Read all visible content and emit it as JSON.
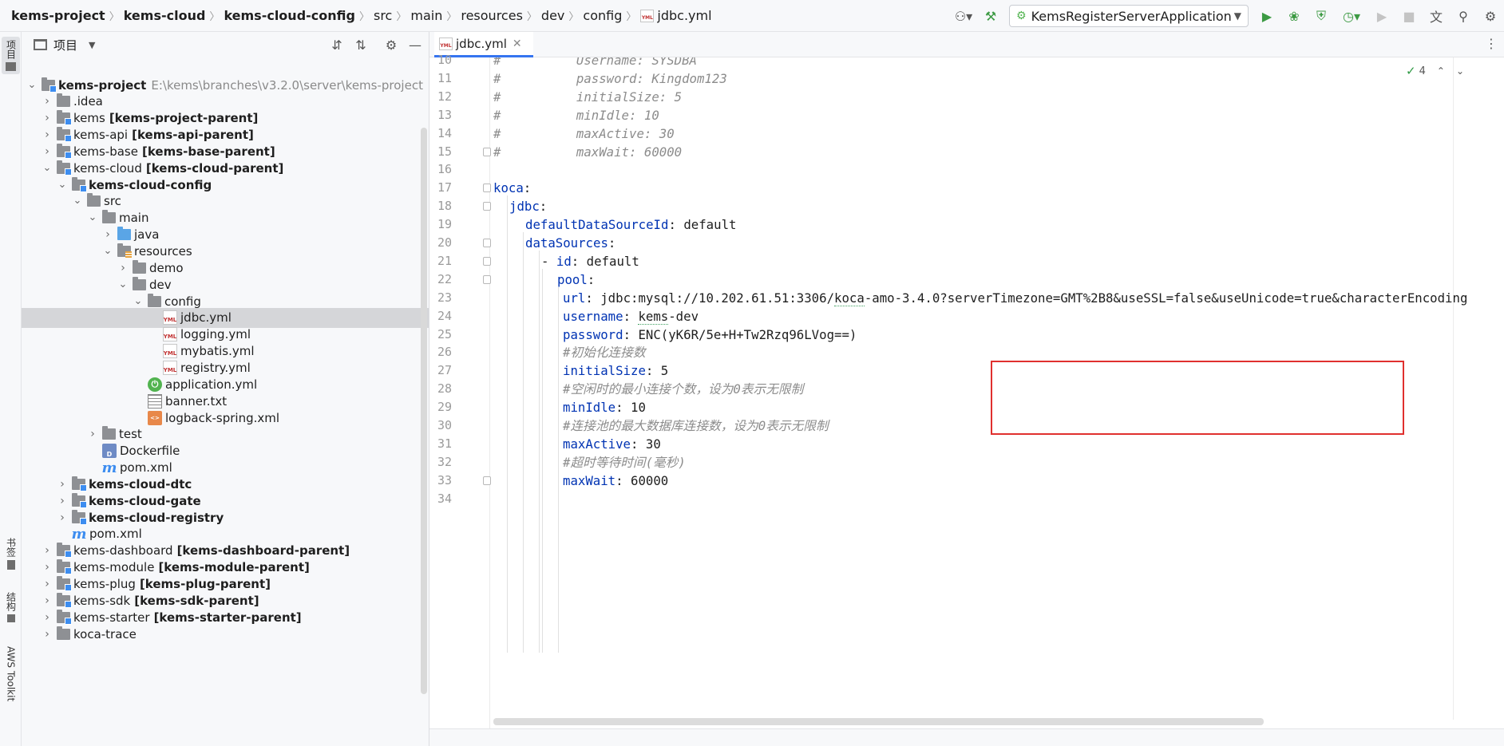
{
  "breadcrumbs": [
    {
      "label": "kems-project",
      "bold": true
    },
    {
      "label": "kems-cloud",
      "bold": true
    },
    {
      "label": "kems-cloud-config",
      "bold": true
    },
    {
      "label": "src",
      "bold": false
    },
    {
      "label": "main",
      "bold": false
    },
    {
      "label": "resources",
      "bold": false
    },
    {
      "label": "dev",
      "bold": false
    },
    {
      "label": "config",
      "bold": false
    },
    {
      "label": "jdbc.yml",
      "bold": false,
      "icon": "yml-file-icon"
    }
  ],
  "toolbar": {
    "run_config_label": "KemsRegisterServerApplication",
    "icons": [
      "user-icon",
      "hammer-icon",
      "run-icon",
      "debug-icon",
      "coverage-icon",
      "profile-icon",
      "resume-icon",
      "stop-icon",
      "translate-icon",
      "search-icon",
      "gear-icon"
    ]
  },
  "left_strip": {
    "project": "项目",
    "bookmarks": "书签",
    "structure": "结构",
    "aws": "AWS Toolkit"
  },
  "panel": {
    "title": "项目"
  },
  "tree": [
    {
      "name": "kems-project",
      "bold": true,
      "path": "E:\\kems\\branches\\v3.2.0\\server\\kems-project",
      "depth": 0,
      "arrow": "open",
      "icon": "module"
    },
    {
      "name": ".idea",
      "depth": 1,
      "arrow": "closed",
      "icon": "folder"
    },
    {
      "name": "kems",
      "suffix": "[kems-project-parent]",
      "depth": 1,
      "arrow": "closed",
      "icon": "module"
    },
    {
      "name": "kems-api",
      "suffix": "[kems-api-parent]",
      "depth": 1,
      "arrow": "closed",
      "icon": "module"
    },
    {
      "name": "kems-base",
      "suffix": "[kems-base-parent]",
      "depth": 1,
      "arrow": "closed",
      "icon": "module"
    },
    {
      "name": "kems-cloud",
      "suffix": "[kems-cloud-parent]",
      "depth": 1,
      "arrow": "open",
      "icon": "module"
    },
    {
      "name": "kems-cloud-config",
      "bold": true,
      "depth": 2,
      "arrow": "open",
      "icon": "module"
    },
    {
      "name": "src",
      "depth": 3,
      "arrow": "open",
      "icon": "folder"
    },
    {
      "name": "main",
      "depth": 4,
      "arrow": "open",
      "icon": "folder"
    },
    {
      "name": "java",
      "depth": 5,
      "arrow": "closed",
      "icon": "src-root"
    },
    {
      "name": "resources",
      "depth": 5,
      "arrow": "open",
      "icon": "res-root"
    },
    {
      "name": "demo",
      "depth": 6,
      "arrow": "closed",
      "icon": "folder"
    },
    {
      "name": "dev",
      "depth": 6,
      "arrow": "open",
      "icon": "folder"
    },
    {
      "name": "config",
      "depth": 7,
      "arrow": "open",
      "icon": "folder"
    },
    {
      "name": "jdbc.yml",
      "depth": 8,
      "arrow": "none",
      "icon": "yml",
      "selected": true
    },
    {
      "name": "logging.yml",
      "depth": 8,
      "arrow": "none",
      "icon": "yml"
    },
    {
      "name": "mybatis.yml",
      "depth": 8,
      "arrow": "none",
      "icon": "yml"
    },
    {
      "name": "registry.yml",
      "depth": 8,
      "arrow": "none",
      "icon": "yml"
    },
    {
      "name": "application.yml",
      "depth": 7,
      "arrow": "none",
      "icon": "spring"
    },
    {
      "name": "banner.txt",
      "depth": 7,
      "arrow": "none",
      "icon": "txt"
    },
    {
      "name": "logback-spring.xml",
      "depth": 7,
      "arrow": "none",
      "icon": "xml"
    },
    {
      "name": "test",
      "depth": 4,
      "arrow": "closed",
      "icon": "folder"
    },
    {
      "name": "Dockerfile",
      "depth": 4,
      "arrow": "none",
      "icon": "docker"
    },
    {
      "name": "pom.xml",
      "depth": 4,
      "arrow": "none",
      "icon": "maven"
    },
    {
      "name": "kems-cloud-dtc",
      "bold": true,
      "depth": 2,
      "arrow": "closed",
      "icon": "module"
    },
    {
      "name": "kems-cloud-gate",
      "bold": true,
      "depth": 2,
      "arrow": "closed",
      "icon": "module"
    },
    {
      "name": "kems-cloud-registry",
      "bold": true,
      "depth": 2,
      "arrow": "closed",
      "icon": "module"
    },
    {
      "name": "pom.xml",
      "depth": 2,
      "arrow": "none",
      "icon": "maven"
    },
    {
      "name": "kems-dashboard",
      "suffix": "[kems-dashboard-parent]",
      "depth": 1,
      "arrow": "closed",
      "icon": "module"
    },
    {
      "name": "kems-module",
      "suffix": "[kems-module-parent]",
      "depth": 1,
      "arrow": "closed",
      "icon": "module"
    },
    {
      "name": "kems-plug",
      "suffix": "[kems-plug-parent]",
      "depth": 1,
      "arrow": "closed",
      "icon": "module"
    },
    {
      "name": "kems-sdk",
      "suffix": "[kems-sdk-parent]",
      "depth": 1,
      "arrow": "closed",
      "icon": "module"
    },
    {
      "name": "kems-starter",
      "suffix": "[kems-starter-parent]",
      "depth": 1,
      "arrow": "closed",
      "icon": "module"
    },
    {
      "name": "koca-trace",
      "depth": 1,
      "arrow": "closed",
      "icon": "folder"
    }
  ],
  "editor": {
    "tab_label": "jdbc.yml",
    "inspection_count": "4",
    "lines": [
      {
        "n": "10",
        "indent": 0,
        "parts": [
          {
            "t": "#          Username: SYSDBA",
            "c": "comment"
          }
        ]
      },
      {
        "n": "11",
        "indent": 0,
        "parts": [
          {
            "t": "#          password: Kingdom123",
            "c": "comment"
          }
        ]
      },
      {
        "n": "12",
        "indent": 0,
        "parts": [
          {
            "t": "#          initialSize: 5",
            "c": "comment"
          }
        ]
      },
      {
        "n": "13",
        "indent": 0,
        "parts": [
          {
            "t": "#          minIdle: 10",
            "c": "comment"
          }
        ]
      },
      {
        "n": "14",
        "indent": 0,
        "parts": [
          {
            "t": "#          maxActive: 30",
            "c": "comment"
          }
        ]
      },
      {
        "n": "15",
        "indent": 0,
        "parts": [
          {
            "t": "#          maxWait: 60000",
            "c": "comment"
          }
        ]
      },
      {
        "n": "16",
        "indent": 0,
        "parts": []
      },
      {
        "n": "17",
        "indent": 0,
        "parts": [
          {
            "t": "koca",
            "c": "key"
          },
          {
            "t": ":",
            "c": "punc"
          }
        ]
      },
      {
        "n": "18",
        "indent": 1,
        "parts": [
          {
            "t": "jdbc",
            "c": "key"
          },
          {
            "t": ":",
            "c": "punc"
          }
        ]
      },
      {
        "n": "19",
        "indent": 2,
        "parts": [
          {
            "t": "defaultDataSourceId",
            "c": "key"
          },
          {
            "t": ": default",
            "c": "val"
          }
        ]
      },
      {
        "n": "20",
        "indent": 2,
        "parts": [
          {
            "t": "dataSources",
            "c": "key"
          },
          {
            "t": ":",
            "c": "punc"
          }
        ]
      },
      {
        "n": "21",
        "indent": 3,
        "parts": [
          {
            "t": "- ",
            "c": "val"
          },
          {
            "t": "id",
            "c": "key"
          },
          {
            "t": ": default",
            "c": "val"
          }
        ]
      },
      {
        "n": "22",
        "indent": 4,
        "parts": [
          {
            "t": "pool",
            "c": "key"
          },
          {
            "t": ":",
            "c": "punc"
          }
        ]
      },
      {
        "n": "23",
        "indent": 5,
        "parts": [
          {
            "t": "url",
            "c": "key"
          },
          {
            "t": ": jdbc:mysql://10.202.61.51:3306/",
            "c": "val"
          },
          {
            "t": "koca",
            "c": "val squig"
          },
          {
            "t": "-amo-3.4.0?serverTimezone=GMT%2B8&useSSL=false&useUnicode=true&characterEncoding",
            "c": "val"
          }
        ]
      },
      {
        "n": "24",
        "indent": 5,
        "parts": [
          {
            "t": "username",
            "c": "key"
          },
          {
            "t": ": ",
            "c": "val"
          },
          {
            "t": "kems",
            "c": "val squig"
          },
          {
            "t": "-dev",
            "c": "val"
          }
        ]
      },
      {
        "n": "25",
        "indent": 5,
        "parts": [
          {
            "t": "password",
            "c": "key"
          },
          {
            "t": ": ENC(yK6R/5e+H+Tw2Rzq96LVog==)",
            "c": "val"
          }
        ]
      },
      {
        "n": "26",
        "indent": 5,
        "parts": [
          {
            "t": "#初始化连接数",
            "c": "comment"
          }
        ]
      },
      {
        "n": "27",
        "indent": 5,
        "parts": [
          {
            "t": "initialSize",
            "c": "key"
          },
          {
            "t": ": 5",
            "c": "val"
          }
        ]
      },
      {
        "n": "28",
        "indent": 5,
        "parts": [
          {
            "t": "#空闲时的最小连接个数，设为0表示无限制",
            "c": "comment"
          }
        ]
      },
      {
        "n": "29",
        "indent": 5,
        "parts": [
          {
            "t": "minIdle",
            "c": "key"
          },
          {
            "t": ": 10",
            "c": "val"
          }
        ]
      },
      {
        "n": "30",
        "indent": 5,
        "parts": [
          {
            "t": "#连接池的最大数据库连接数，设为0表示无限制",
            "c": "comment"
          }
        ]
      },
      {
        "n": "31",
        "indent": 5,
        "parts": [
          {
            "t": "maxActive",
            "c": "key"
          },
          {
            "t": ": 30",
            "c": "val"
          }
        ]
      },
      {
        "n": "32",
        "indent": 5,
        "parts": [
          {
            "t": "#超时等待时间(毫秒)",
            "c": "comment"
          }
        ]
      },
      {
        "n": "33",
        "indent": 5,
        "parts": [
          {
            "t": "maxWait",
            "c": "key"
          },
          {
            "t": ": 60000",
            "c": "val"
          }
        ]
      },
      {
        "n": "34",
        "indent": 0,
        "parts": []
      }
    ]
  }
}
